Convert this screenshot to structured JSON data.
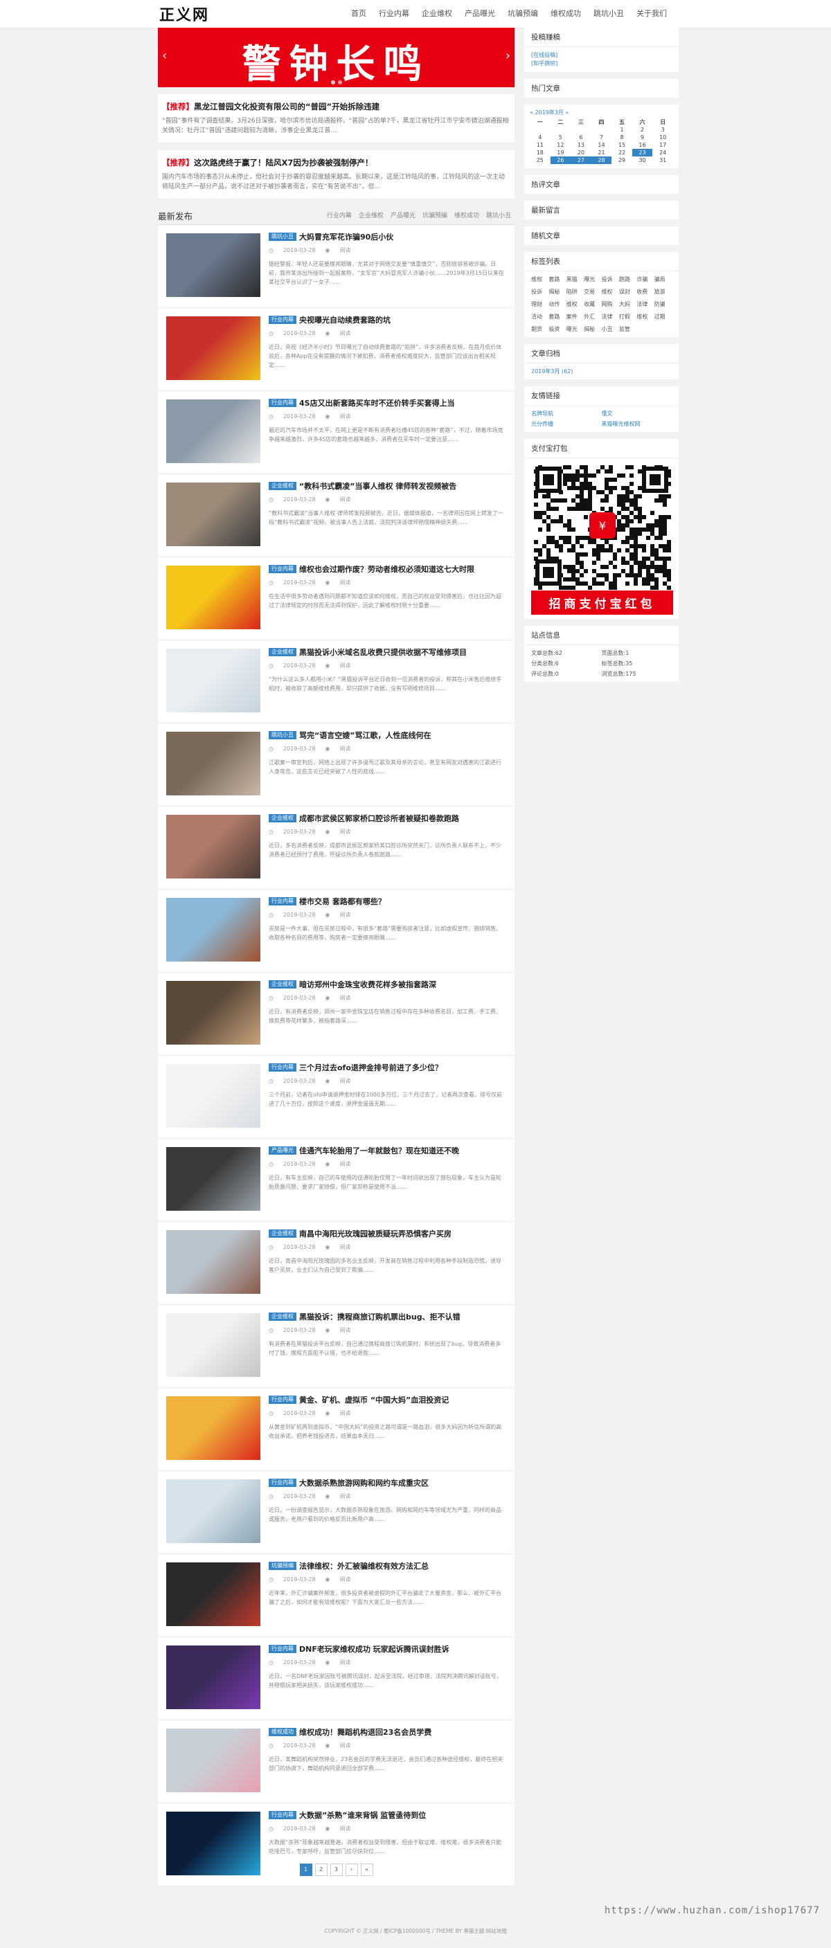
{
  "site": {
    "logo": "正义网"
  },
  "nav": [
    "首页",
    "行业内幕",
    "企业维权",
    "产品曝光",
    "坑骗预编",
    "维权成功",
    "跳坑小丑",
    "关于我们"
  ],
  "banner": {
    "text": "警钟长鸣",
    "prev": "‹",
    "next": "›"
  },
  "featured": [
    {
      "tag": "【推荐】",
      "title": "黑龙江普园文化投资有限公司的“普园”开始拆除违建",
      "excerpt": "“普园”事件有了调查结果。3月26日深夜，哈尔滨市信访局通报称，“普园”占的单7千，黑龙江省牡丹江市宁安市镜泊湖通报相关情况：牡丹江“普园”违建问题较为清晰，涉事企业黑龙江普…"
    },
    {
      "tag": "【推荐】",
      "title": "这次路虎终于赢了！陆风X7因为抄袭被强制停产！",
      "excerpt": "国内汽车市场的事态只从未停止，但社会对于抄袭的容忍度越来越高。长期以来，这是江铃陆风的事，江铃陆风的这一次主动将陆风生产一部分产品，说不过还对于被抄袭者而言，实在“有苦说不出”。但…"
    }
  ],
  "latest": {
    "heading": "最新发布",
    "tabs": [
      "行业内幕",
      "企业维权",
      "产品曝光",
      "坑骗预编",
      "维权成功",
      "跳坑小丑"
    ]
  },
  "articles": [
    {
      "cat": "跳坑小丑",
      "title": "大妈冒充军花诈骗90后小伙",
      "date": "2019-03-28",
      "views": "阅读",
      "excerpt": "据经警报、年轻人还是要擦亮眼睛，尤其对于网络交友要“慎重慎交”，否则很容易被诈骗。日前，我市某派出所接到一起报案称，“女军官”大妈冒充军人诈骗小伙……2019年3月15日以来在某社交平台认识了一女子……"
    },
    {
      "cat": "行业内幕",
      "title": "央视曝光自动续费套路的坑",
      "date": "2019-03-28",
      "views": "阅读",
      "excerpt": "近日，央视《经济半小时》节目曝光了自动续费套路的“陷阱”，许多消费者反映，在首月低价体验后，各种App在没有提醒的情况下被扣费，消费者维权难度较大，监管部门应该出台相关规定……"
    },
    {
      "cat": "行业内幕",
      "title": "4S店又出新套路买车时不还价转手买套得上当",
      "date": "2019-03-28",
      "views": "阅读",
      "excerpt": "最近的汽车市场并不太平，在网上更是不断有消费者吐槽4S店的各种“套路”，不过，随着市场竞争越来越激烈，许多4S店的套路也越来越多，消费者在买车时一定要注意……"
    },
    {
      "cat": "企业维权",
      "title": "“教科书式霸凌”当事人维权 律师转发视频被告",
      "date": "2019-03-28",
      "views": "阅读",
      "excerpt": "“教科书式霸凌”当事人维权 律师转发视频被告。近日，据媒体报道，一名律师因在网上转发了一段“教科书式霸凌”视频，被当事人告上法庭，法院判决该律师赔偿精神损失费……"
    },
    {
      "cat": "行业内幕",
      "title": "维权也会过期作废？劳动者维权必须知道这七大时限",
      "date": "2019-03-28",
      "views": "阅读",
      "excerpt": "在生活中很多劳动者遇到问题都不知道应该如何维权，而自己的权益受到侵害后，也往往因为超过了法律规定的时效而无法得到保护，因此了解维权时限十分重要……"
    },
    {
      "cat": "企业维权",
      "title": "黑猫投诉小米域名乱收费只提供收据不写维修项目",
      "date": "2019-03-28",
      "views": "阅读",
      "excerpt": "“为什么这么多人都用小米？”黑猫投诉平台近日收到一位消费者的投诉，称其在小米售后维修手机时，被收取了高额维修费用，却只提供了收据，没有写明维修项目……"
    },
    {
      "cat": "跳坑小丑",
      "title": "骂完“语言空嫂”骂江歌，人性底线何在",
      "date": "2019-03-28",
      "views": "阅读",
      "excerpt": "江歌案一审宣判后，网络上出现了许多谩骂江歌及其母亲的言论，甚至有网友对遇害的江歌进行人身攻击，这些言论已经突破了人性的底线……"
    },
    {
      "cat": "企业维权",
      "title": "成都市武侯区郭家桥口腔诊所者被疑扣卷款跑路",
      "date": "2019-03-28",
      "views": "阅读",
      "excerpt": "近日，多名消费者反映，成都市武侯区郭家桥某口腔诊所突然关门，诊所负责人联系不上，不少消费者已经预付了费用，怀疑诊所负责人卷款跑路……"
    },
    {
      "cat": "行业内幕",
      "title": "楼市交易 套路都有哪些？",
      "date": "2019-03-28",
      "views": "阅读",
      "excerpt": "买房是一件大事，但在买房过程中，有很多“套路”需要购房者注意，比如虚假宣传、捆绑销售、收取各种名目的费用等，购房者一定要擦亮眼睛……"
    },
    {
      "cat": "企业维权",
      "title": "暗访郑州中金珠宝收费花样多被指套路深",
      "date": "2019-03-28",
      "views": "阅读",
      "excerpt": "近日，有消费者反映，郑州一家中金珠宝店在销售过程中存在多种收费名目，加工费、手工费、换款费等花样繁多，被指套路深……"
    },
    {
      "cat": "行业内幕",
      "title": "三个月过去ofo退押金排号前进了多少位？",
      "date": "2019-03-28",
      "views": "阅读",
      "excerpt": "三个月前，记者在ofo申请退押金时排在1000多万位，三个月过去了，记者再次查看，排号仅前进了几十万位，按照这个速度，退押金遥遥无期……"
    },
    {
      "cat": "产品曝光",
      "title": "佳通汽车轮胎用了一年就鼓包？现在知道还不晚",
      "date": "2019-03-28",
      "views": "阅读",
      "excerpt": "近日，有车主反映，自己的车使用的佳通轮胎仅用了一年时间就出现了鼓包现象，车主认为是轮胎质量问题，要求厂家赔偿，但厂家却称是使用不当……"
    },
    {
      "cat": "企业维权",
      "title": "南昌中海阳光玫瑰园被质疑玩弄恐惧客户买房",
      "date": "2019-03-28",
      "views": "阅读",
      "excerpt": "近日，南昌中海阳光玫瑰园的多名业主反映，开发商在销售过程中利用各种手段制造恐慌，诱导客户买房，业主们认为自己受到了欺骗……"
    },
    {
      "cat": "企业维权",
      "title": "黑猫投诉：携程商旅订购机票出bug、拒不认错",
      "date": "2019-03-28",
      "views": "阅读",
      "excerpt": "有消费者在黑猫投诉平台反映，自己通过携程商旅订购机票时，系统出现了bug，导致消费者多付了钱，携程方面拒不认错，也不给退款……"
    },
    {
      "cat": "行业内幕",
      "title": "黄金、矿机、虚拟币 “中国大妈”血泪投资记",
      "date": "2019-03-28",
      "views": "阅读",
      "excerpt": "从黄金到矿机再到虚拟币，“中国大妈”的投资之路可谓是一路血泪，很多大妈因为听信所谓的高收益承诺，把养老钱投进去，结果血本无归……"
    },
    {
      "cat": "行业内幕",
      "title": "大数据杀熟旅游网购和网约车成重灾区",
      "date": "2019-03-28",
      "views": "阅读",
      "excerpt": "近日，一份调查报告显示，大数据杀熟现象在旅游、网购和网约车等领域尤为严重，同样的商品或服务，老用户看到的价格反而比新用户高……"
    },
    {
      "cat": "坑骗预编",
      "title": "法律维权：外汇被骗维权有效方法汇总",
      "date": "2019-03-28",
      "views": "阅读",
      "excerpt": "近年来，外汇诈骗案件频发，很多投资者被虚假的外汇平台骗走了大量资金，那么，被外汇平台骗了之后，如何才能有效维权呢？下面为大家汇总一些方法……"
    },
    {
      "cat": "行业内幕",
      "title": "DNF老玩家维权成功 玩家起诉腾讯误封胜诉",
      "date": "2019-03-28",
      "views": "阅读",
      "excerpt": "近日，一名DNF老玩家因账号被腾讯误封，起诉至法院，经过审理，法院判决腾讯解封该账号，并赔偿玩家相关损失，该玩家维权成功……"
    },
    {
      "cat": "维权成功",
      "title": "维权成功！舞蹈机构退回23名会员学费",
      "date": "2019-03-28",
      "views": "阅读",
      "excerpt": "近日，某舞蹈机构突然停业，23名会员的学费无法退还，会员们通过各种途径维权，最终在相关部门的协调下，舞蹈机构同意退回全部学费……"
    },
    {
      "cat": "行业内幕",
      "title": "大数据”杀熟”谁来背锅 监管亟待到位",
      "date": "2019-03-28",
      "views": "阅读",
      "excerpt": "大数据“杀熟”现象越来越普遍，消费者权益受到侵害，但由于取证难、维权难，很多消费者只能吃哑巴亏，专家呼吁，监管部门应尽快到位……"
    }
  ],
  "pager": [
    "1",
    "2",
    "3",
    "›",
    "»"
  ],
  "sidebar": {
    "w1": {
      "title": "投稿赚稿",
      "links": [
        "[在线投稿]",
        "[知乎旗帜]"
      ]
    },
    "w2": {
      "title": "热门文章"
    },
    "cal": {
      "header": "« 2019年3月 »",
      "weekdays": [
        "一",
        "二",
        "三",
        "四",
        "五",
        "六",
        "日"
      ],
      "rows": [
        [
          "",
          "",
          "",
          "",
          "1",
          "2",
          "3"
        ],
        [
          "4",
          "5",
          "6",
          "7",
          "8",
          "9",
          "10"
        ],
        [
          "11",
          "12",
          "13",
          "14",
          "15",
          "16",
          "17"
        ],
        [
          "18",
          "19",
          "20",
          "21",
          "22",
          "23",
          "24"
        ],
        [
          "25",
          "26",
          "27",
          "28",
          "29",
          "30",
          "31"
        ]
      ]
    },
    "w3": {
      "title": "热评文章"
    },
    "w4": {
      "title": "最新留言"
    },
    "w5": {
      "title": "随机文章"
    },
    "tags": {
      "title": "标签列表",
      "items": [
        "维权",
        "套路",
        "黑猫",
        "曝光",
        "投诉",
        "跑路",
        "诈骗",
        "骗局",
        "投诉",
        "揭秘",
        "陷阱",
        "交易",
        "维权",
        "误封",
        "收费",
        "旅游",
        "理财",
        "动作",
        "维权",
        "收藏",
        "网购",
        "大妈",
        "法律",
        "防骗",
        "活动",
        "套路",
        "案件",
        "外汇",
        "法律",
        "打假",
        "维权",
        "过期",
        "期货",
        "投资",
        "曝光",
        "揭秘",
        "小丑",
        "监管"
      ]
    },
    "arch": {
      "title": "文章归档",
      "item": "2019年3月 (62)"
    },
    "links": {
      "title": "友情链接",
      "items": [
        "名牌导航",
        "懂文",
        "光分传播",
        "黑猫曝光维权网"
      ]
    },
    "pay": {
      "title": "支付宝打包",
      "caption": "招商支付宝红包"
    },
    "stats": {
      "title": "站点信息",
      "items": [
        "文章总数:62",
        "页面总数:1",
        "分类总数:6",
        "标签总数:35",
        "评论总数:0",
        "浏览总数:175"
      ]
    }
  },
  "footer": {
    "text": "COPYRIGHT © 正义网 / 蜀ICP备1000000号 / THEME BY 黑猫主题 网站地图"
  },
  "watermark": "https://www.huzhan.com/ishop17677",
  "colors": {
    "accent": "#3385c6",
    "banner": "#e60012",
    "tag": "#e60012"
  }
}
